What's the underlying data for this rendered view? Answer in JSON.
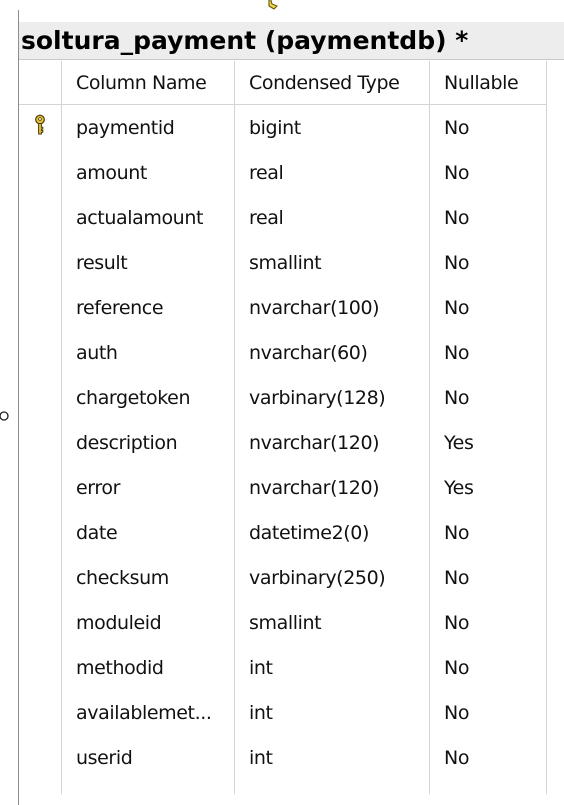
{
  "table": {
    "title": "soltura_payment (paymentdb) *",
    "columns": [
      "Column Name",
      "Condensed Type",
      "Nullable"
    ],
    "rows": [
      {
        "key": true,
        "name": "paymentid",
        "type": "bigint",
        "nullable": "No"
      },
      {
        "key": false,
        "name": "amount",
        "type": "real",
        "nullable": "No"
      },
      {
        "key": false,
        "name": "actualamount",
        "type": "real",
        "nullable": "No"
      },
      {
        "key": false,
        "name": "result",
        "type": "smallint",
        "nullable": "No"
      },
      {
        "key": false,
        "name": "reference",
        "type": "nvarchar(100)",
        "nullable": "No"
      },
      {
        "key": false,
        "name": "auth",
        "type": "nvarchar(60)",
        "nullable": "No"
      },
      {
        "key": false,
        "name": "chargetoken",
        "type": "varbinary(128)",
        "nullable": "No"
      },
      {
        "key": false,
        "name": "description",
        "type": "nvarchar(120)",
        "nullable": "Yes"
      },
      {
        "key": false,
        "name": "error",
        "type": "nvarchar(120)",
        "nullable": "Yes"
      },
      {
        "key": false,
        "name": "date",
        "type": "datetime2(0)",
        "nullable": "No"
      },
      {
        "key": false,
        "name": "checksum",
        "type": "varbinary(250)",
        "nullable": "No"
      },
      {
        "key": false,
        "name": "moduleid",
        "type": "smallint",
        "nullable": "No"
      },
      {
        "key": false,
        "name": "methodid",
        "type": "int",
        "nullable": "No"
      },
      {
        "key": false,
        "name": "availablemet...",
        "type": "int",
        "nullable": "No"
      },
      {
        "key": false,
        "name": "userid",
        "type": "int",
        "nullable": "No"
      }
    ]
  },
  "icons": {
    "primary_key": "key-icon",
    "relationship_top": "relationship-connector-icon",
    "relationship_left": "relationship-end-icon"
  },
  "colors": {
    "title_bg": "#ededed",
    "key_gold": "#e8c33a",
    "grid_line": "#d4d4d4"
  }
}
